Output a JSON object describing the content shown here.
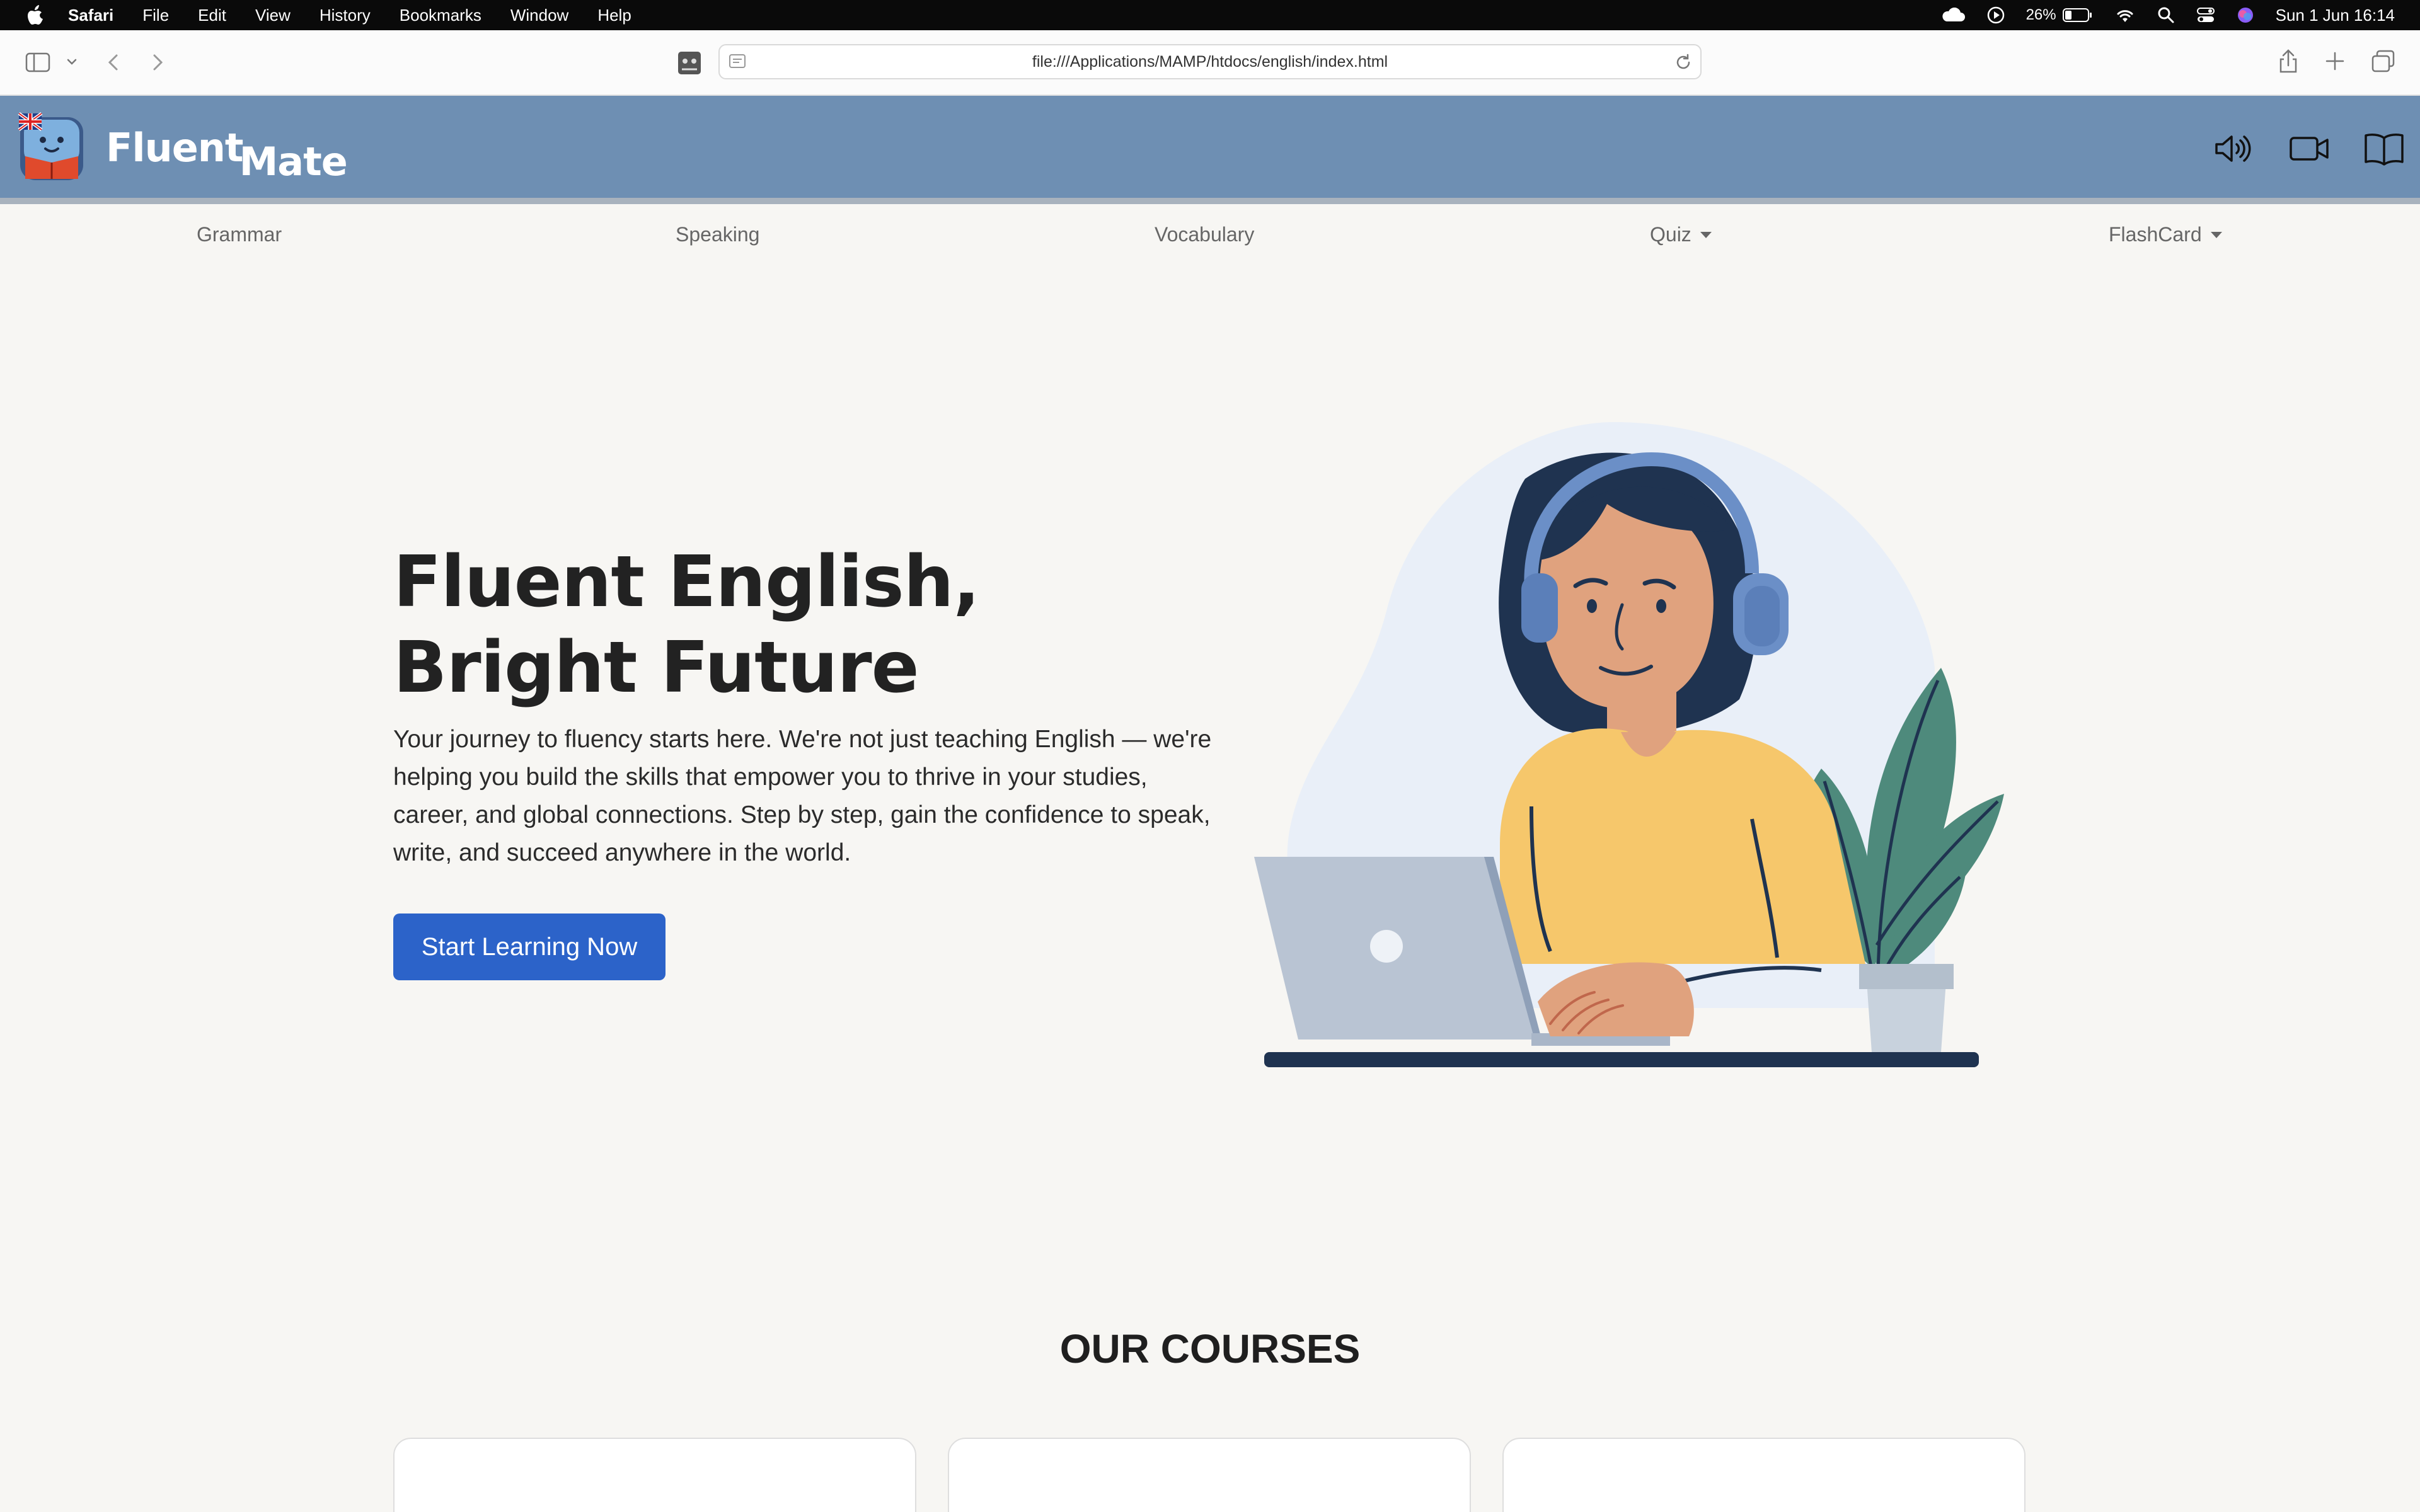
{
  "menubar": {
    "app": "Safari",
    "items": [
      "File",
      "Edit",
      "View",
      "History",
      "Bookmarks",
      "Window",
      "Help"
    ],
    "battery": "26%",
    "datetime": "Sun 1 Jun  16:14"
  },
  "browser": {
    "url": "file:///Applications/MAMP/htdocs/english/index.html"
  },
  "site": {
    "logo_word1": "Fluent",
    "logo_word2": "Mate",
    "header_icons": [
      "speaker-icon",
      "video-icon",
      "book-icon"
    ]
  },
  "nav": {
    "items": [
      {
        "label": "Grammar",
        "dropdown": false
      },
      {
        "label": "Speaking",
        "dropdown": false
      },
      {
        "label": "Vocabulary",
        "dropdown": false
      },
      {
        "label": "Quiz",
        "dropdown": true
      },
      {
        "label": "FlashCard",
        "dropdown": true
      }
    ]
  },
  "hero": {
    "title": "Fluent English, Bright Future",
    "text": "Your journey to fluency starts here. We're not just teaching English — we're helping you build the skills that empower you to thrive in your studies, career, and global connections. Step by step, gain the confidence to speak, write, and succeed anywhere in the world.",
    "cta": "Start Learning Now"
  },
  "courses": {
    "title": "OUR COURSES",
    "card_count": 3
  },
  "colors": {
    "header_bg": "#6e8fb3",
    "page_bg": "#f7f6f3",
    "cta_bg": "#2c63c9"
  }
}
